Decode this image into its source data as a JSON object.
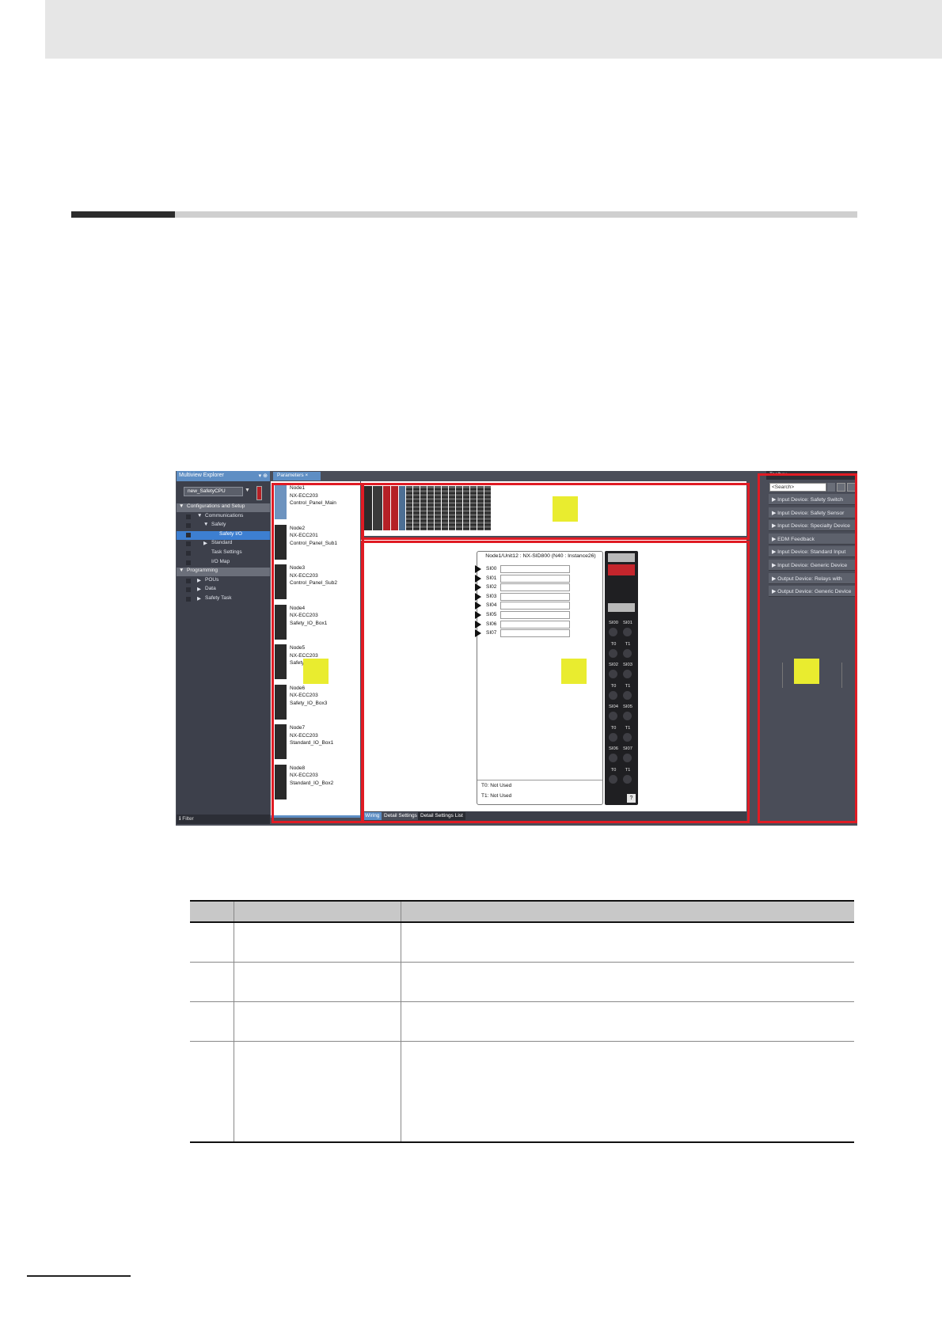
{
  "screenshot": {
    "explorer": {
      "title": "Multiview Explorer",
      "pin": "▾ ⊕",
      "controller": "new_SafetyCPU",
      "tree": [
        {
          "label": "Configurations and Setup",
          "level": 0,
          "header": true
        },
        {
          "label": "Communications",
          "level": 1
        },
        {
          "label": "Safety",
          "level": 2
        },
        {
          "label": "Safety I/O",
          "level": 3,
          "selected": true
        },
        {
          "label": "Standard",
          "level": 2
        },
        {
          "label": "Task Settings",
          "level": 2
        },
        {
          "label": "I/O Map",
          "level": 2
        },
        {
          "label": "Programming",
          "level": 0,
          "header": true
        },
        {
          "label": "POUs",
          "level": 1
        },
        {
          "label": "Data",
          "level": 1
        },
        {
          "label": "Safety Task",
          "level": 1
        }
      ],
      "filter": "Filter"
    },
    "parameters_tab": "Parameters ×",
    "nodes": [
      {
        "name": "Node1",
        "model": "NX-ECC203",
        "label": "Control_Panel_Main"
      },
      {
        "name": "Node2",
        "model": "NX-ECC201",
        "label": "Control_Panel_Sub1"
      },
      {
        "name": "Node3",
        "model": "NX-ECC203",
        "label": "Control_Panel_Sub2"
      },
      {
        "name": "Node4",
        "model": "NX-ECC203",
        "label": "Safety_IO_Box1"
      },
      {
        "name": "Node5",
        "model": "NX-ECC203",
        "label": "Safety_IO_Box2"
      },
      {
        "name": "Node6",
        "model": "NX-ECC203",
        "label": "Safety_IO_Box3"
      },
      {
        "name": "Node7",
        "model": "NX-ECC203",
        "label": "Standard_IO_Box1"
      },
      {
        "name": "Node8",
        "model": "NX-ECC203",
        "label": "Standard_IO_Box2"
      }
    ],
    "unit_title": "Node1/Unit12 : NX-SID800 (N40 : Instance26)",
    "inputs": [
      "SI00",
      "SI01",
      "SI02",
      "SI03",
      "SI04",
      "SI05",
      "SI06",
      "SI07"
    ],
    "t0_status": "T0: Not Used",
    "t1_status": "T1: Not Used",
    "terminal_labels": [
      [
        "SI00",
        "SI01"
      ],
      [
        "T0",
        "T1"
      ],
      [
        "SI02",
        "SI03"
      ],
      [
        "T0",
        "T1"
      ],
      [
        "SI04",
        "SI05"
      ],
      [
        "T0",
        "T1"
      ],
      [
        "SI06",
        "SI07"
      ],
      [
        "T0",
        "T1"
      ]
    ],
    "help": "?",
    "tabs": [
      "Wiring",
      "Detail Settings",
      "Detail Settings List"
    ],
    "toolbox": {
      "title": "Toolbox",
      "search_placeholder": "<Search>",
      "items": [
        "Input Device: Safety Switch",
        "Input Device: Safety Sensor",
        "Input Device: Specialty Device",
        "EDM Feedback",
        "Input Device: Standard Input",
        "Input Device: Generic Device",
        "Output Device: Relays with",
        "Output Device: Generic Device"
      ]
    },
    "colors": {
      "accent": "#5e8ec4",
      "callout": "#e01b24",
      "marker": "#e9ec2f",
      "module_red": "#b52026"
    }
  },
  "table": {
    "rows": 4
  }
}
